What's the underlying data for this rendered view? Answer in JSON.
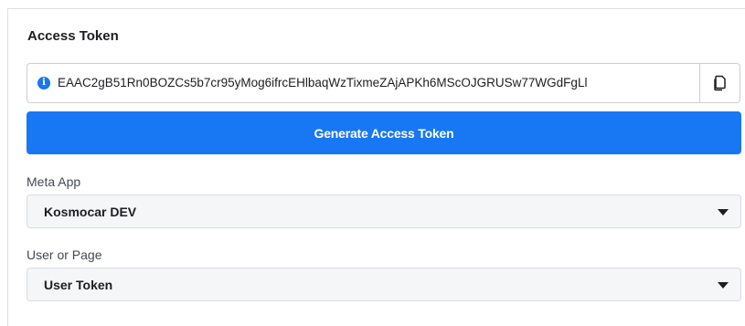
{
  "access_token": {
    "title": "Access Token",
    "token_value": "EAAC2gB51Rn0BOZCs5b7cr95yMog6ifrcEHlbaqWzTixmeZAjAPKh6MScOJGRUSw77WGdFgLl",
    "info_icon": "info-icon",
    "copy_icon": "copy-icon",
    "generate_label": "Generate Access Token"
  },
  "meta_app": {
    "label": "Meta App",
    "value": "Kosmocar DEV"
  },
  "user_or_page": {
    "label": "User or Page",
    "value": "User Token"
  },
  "colors": {
    "accent": "#1877f2",
    "border": "#ccd0d5",
    "select_bg": "#f5f6f7"
  }
}
